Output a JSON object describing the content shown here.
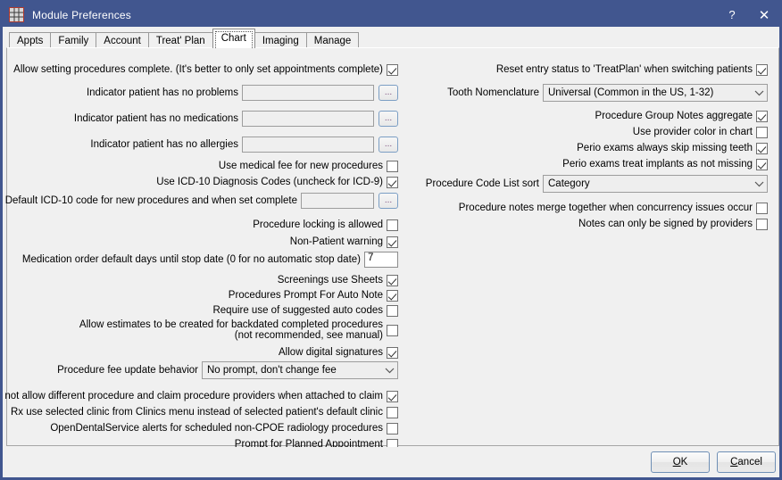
{
  "window": {
    "title": "Module Preferences",
    "icon": "module-grid-icon",
    "help_label": "?",
    "close_label": "✕",
    "titlebar_color": "#41568f",
    "panel_color": "#f0f0f0"
  },
  "tabs": [
    {
      "label": "Appts",
      "selected": false
    },
    {
      "label": "Family",
      "selected": false
    },
    {
      "label": "Account",
      "selected": false
    },
    {
      "label": "Treat' Plan",
      "selected": false
    },
    {
      "label": "Chart",
      "selected": true
    },
    {
      "label": "Imaging",
      "selected": false
    },
    {
      "label": "Manage",
      "selected": false
    }
  ],
  "left": {
    "allow_setting_complete": {
      "label": "Allow setting procedures complete.  (It's better to only set appointments complete)",
      "checked": true
    },
    "indicator_no_problems": {
      "label": "Indicator patient has no problems",
      "value": "",
      "button_label": "..."
    },
    "indicator_no_medications": {
      "label": "Indicator patient has no medications",
      "value": "",
      "button_label": "..."
    },
    "indicator_no_allergies": {
      "label": "Indicator patient has no allergies",
      "value": "",
      "button_label": "..."
    },
    "medical_fee": {
      "label": "Use medical fee for new procedures",
      "checked": false
    },
    "icd10_codes": {
      "label": "Use ICD-10 Diagnosis Codes (uncheck for ICD-9)",
      "checked": true
    },
    "default_icd10": {
      "label": "Default ICD-10 code for new procedures and when set complete",
      "value": "",
      "button_label": "..."
    },
    "procedure_locking": {
      "label": "Procedure locking is allowed",
      "checked": false
    },
    "non_patient_warning": {
      "label": "Non-Patient warning",
      "checked": true
    },
    "medication_order_days": {
      "label": "Medication order default days until stop date (0 for no automatic stop date)",
      "value": "7"
    },
    "screenings_sheets": {
      "label": "Screenings use Sheets",
      "checked": true
    },
    "prompt_auto_note": {
      "label": "Procedures Prompt For Auto Note",
      "checked": true
    },
    "require_auto_codes": {
      "label": "Require use of suggested auto codes",
      "checked": false
    },
    "backdated_estimates": {
      "label_line1": "Allow estimates to be created for backdated completed procedures",
      "label_line2": "(not recommended, see manual)",
      "checked": false
    },
    "digital_signatures": {
      "label": "Allow digital signatures",
      "checked": true
    },
    "fee_update_behavior": {
      "label": "Procedure fee update behavior",
      "value": "No prompt, don't change fee"
    },
    "different_providers": {
      "label": "Do not allow different procedure and claim procedure providers when attached to claim",
      "checked": true
    },
    "rx_selected_clinic": {
      "label": "Rx use selected clinic from Clinics menu instead of selected patient's default clinic",
      "checked": false
    },
    "ods_alerts": {
      "label": "OpenDentalService alerts for scheduled non-CPOE radiology procedures",
      "checked": false
    },
    "prompt_planned_appt": {
      "label": "Prompt for Planned Appointment",
      "checked": false
    }
  },
  "right": {
    "reset_entry_status": {
      "label": "Reset entry status to 'TreatPlan' when switching patients",
      "checked": true
    },
    "tooth_nomenclature": {
      "label": "Tooth Nomenclature",
      "value": "Universal (Common in the US, 1-32)"
    },
    "group_notes_aggregate": {
      "label": "Procedure Group Notes aggregate",
      "checked": true
    },
    "provider_color": {
      "label": "Use provider color in chart",
      "checked": false
    },
    "perio_skip_missing": {
      "label": "Perio exams always skip missing teeth",
      "checked": true
    },
    "perio_implants": {
      "label": "Perio exams treat implants as not missing",
      "checked": true
    },
    "proc_code_list_sort": {
      "label": "Procedure Code List sort",
      "value": "Category"
    },
    "notes_merge": {
      "label": "Procedure notes merge together when concurrency issues occur",
      "checked": false
    },
    "notes_signed_providers": {
      "label": "Notes can only be signed by providers",
      "checked": false
    }
  },
  "footer": {
    "ok_label": "OK",
    "ok_accel": "O",
    "cancel_label": "Cancel",
    "cancel_accel": "C"
  }
}
